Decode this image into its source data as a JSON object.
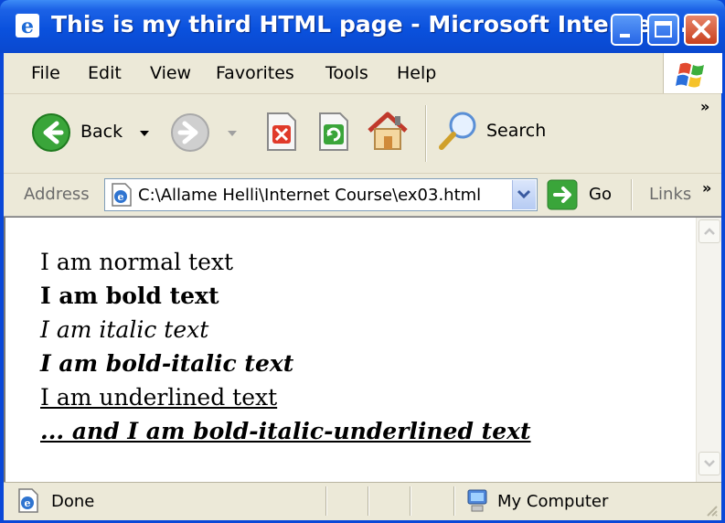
{
  "window": {
    "title": "This is my third HTML page - Microsoft Internet..."
  },
  "menubar": {
    "items": [
      "File",
      "Edit",
      "View",
      "Favorites",
      "Tools",
      "Help"
    ]
  },
  "toolbar": {
    "back_label": "Back",
    "search_label": "Search",
    "overflow": "»"
  },
  "addressbar": {
    "label": "Address",
    "value": "C:\\Allame Helli\\Internet Course\\ex03.html",
    "go_label": "Go",
    "links_label": "Links",
    "overflow": "»"
  },
  "document": {
    "lines": [
      "I am normal text",
      "I am bold text",
      "I am italic text",
      "I am bold-italic text",
      "I am underlined text",
      "... and I am bold-italic-underlined text"
    ]
  },
  "statusbar": {
    "status": "Done",
    "zone": "My Computer"
  },
  "colors": {
    "titlebar": "#0a51dd",
    "chrome": "#ece9d8",
    "close_button": "#c8401e"
  }
}
